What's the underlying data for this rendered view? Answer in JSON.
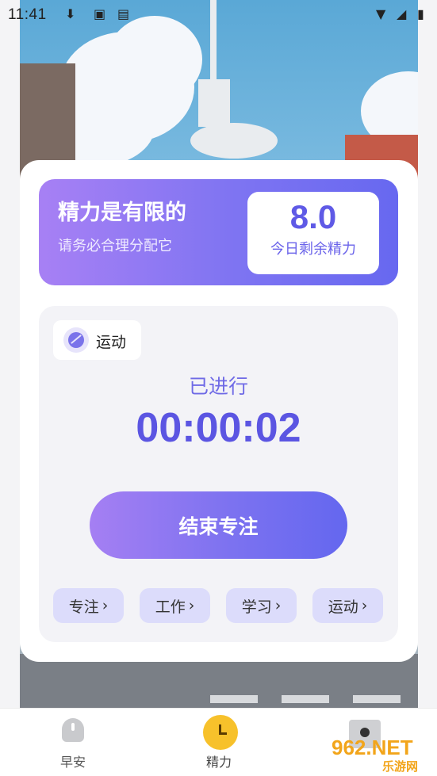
{
  "status_bar": {
    "time": "11:41"
  },
  "energy_card": {
    "title": "精力是有限的",
    "subtitle": "请务必合理分配它",
    "value": "8.0",
    "value_label": "今日剩余精力"
  },
  "timer": {
    "tag_label": "运动",
    "elapsed_label": "已进行",
    "elapsed_time": "00:00:02",
    "end_button": "结束专注"
  },
  "categories": [
    {
      "label": "专注"
    },
    {
      "label": "工作"
    },
    {
      "label": "学习"
    },
    {
      "label": "运动"
    }
  ],
  "bottom_nav": [
    {
      "label": "早安"
    },
    {
      "label": "精力"
    },
    {
      "label": ""
    }
  ],
  "watermark": {
    "number": "962.NET",
    "text": "乐游网"
  },
  "colors": {
    "accent": "#5b55e2",
    "gradient_start": "#a780f4",
    "gradient_end": "#6768f0",
    "chip_bg": "#dcdcfb",
    "nav_active": "#f7c12b"
  }
}
